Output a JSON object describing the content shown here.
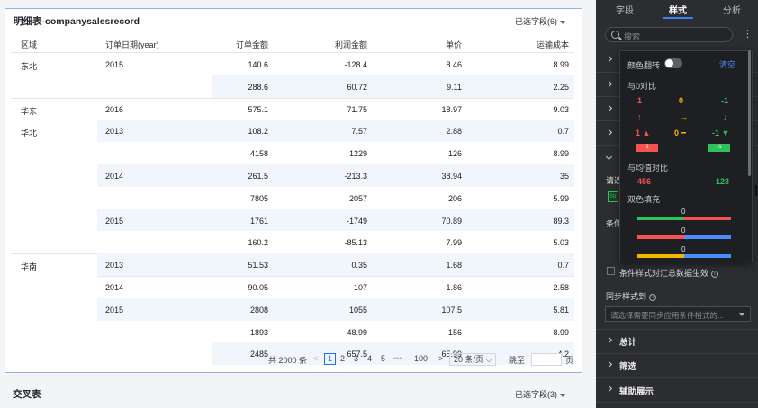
{
  "table_card": {
    "title": "明细表-companysalesrecord",
    "fields_selected": "已选字段(6)",
    "columns": [
      "区域",
      "订单日期(year)",
      "订单金额",
      "利润金额",
      "单价",
      "运输成本"
    ],
    "rows": [
      {
        "region": "东北",
        "year": "2015",
        "amount": "140.6",
        "profit": "-128.4",
        "price": "8.46",
        "cost": "8.99"
      },
      {
        "region": "",
        "year": "",
        "amount": "288.6",
        "profit": "60.72",
        "price": "9.11",
        "cost": "2.25"
      },
      {
        "region": "华东",
        "year": "2016",
        "amount": "575.1",
        "profit": "71.75",
        "price": "18.97",
        "cost": "9.03"
      },
      {
        "region": "华北",
        "year": "2013",
        "amount": "108.2",
        "profit": "7.57",
        "price": "2.88",
        "cost": "0.7"
      },
      {
        "region": "",
        "year": "",
        "amount": "4158",
        "profit": "1229",
        "price": "126",
        "cost": "8.99"
      },
      {
        "region": "",
        "year": "2014",
        "amount": "261.5",
        "profit": "-213.3",
        "price": "38.94",
        "cost": "35"
      },
      {
        "region": "",
        "year": "",
        "amount": "7805",
        "profit": "2057",
        "price": "206",
        "cost": "5.99"
      },
      {
        "region": "",
        "year": "2015",
        "amount": "1761",
        "profit": "-1749",
        "price": "70.89",
        "cost": "89.3"
      },
      {
        "region": "",
        "year": "",
        "amount": "160.2",
        "profit": "-85.13",
        "price": "7.99",
        "cost": "5.03"
      },
      {
        "region": "华南",
        "year": "2013",
        "amount": "51.53",
        "profit": "0.35",
        "price": "1.68",
        "cost": "0.7"
      },
      {
        "region": "",
        "year": "2014",
        "amount": "90.05",
        "profit": "-107",
        "price": "1.86",
        "cost": "2.58"
      },
      {
        "region": "",
        "year": "2015",
        "amount": "2808",
        "profit": "1055",
        "price": "107.5",
        "cost": "5.81"
      },
      {
        "region": "",
        "year": "",
        "amount": "1893",
        "profit": "48.99",
        "price": "156",
        "cost": "8.99"
      },
      {
        "region": "",
        "year": "",
        "amount": "2485",
        "profit": "657.5",
        "price": "65.99",
        "cost": "4.2"
      }
    ],
    "pagination": {
      "total": "共 2000 条",
      "prev": "<",
      "pages": [
        "1",
        "2",
        "3",
        "4",
        "5"
      ],
      "ellipsis": "•••",
      "last": "100",
      "next": ">",
      "page_size": "20 条/页",
      "jump_label": "跳至",
      "page_suffix": "页"
    }
  },
  "cross_card": {
    "title": "交叉表",
    "fields_selected": "已选字段(3)"
  },
  "panel": {
    "tabs": [
      "字段",
      "样式",
      "分析"
    ],
    "search_placeholder": "搜索",
    "partial_label_1": "请选",
    "partial_pill": "Str",
    "partial_label_2": "条件",
    "summary_checkbox": "条件样式对汇总数据生效",
    "sync_label": "同步样式到",
    "sync_placeholder": "请选择需要同步应用条件格式的...",
    "sections": [
      "总计",
      "筛选",
      "辅助展示"
    ]
  },
  "popup": {
    "flip_label": "颜色翻转",
    "clear": "清空",
    "zero_compare": "与0对比",
    "nums": [
      "1",
      "0",
      "-1"
    ],
    "arrow_row": [
      "↑",
      "→",
      "↓"
    ],
    "arrow_text_row": [
      "1",
      "0",
      "-1"
    ],
    "badges": [
      "1",
      "-1"
    ],
    "mean_compare": "与均值对比",
    "mean_values": [
      "456",
      "123"
    ],
    "dual_fill": "双色填充",
    "bar_zero": "0",
    "colors": {
      "red": "#f5534f",
      "yellow": "#f5b400",
      "green": "#2fc25b",
      "blue": "#4b8dff"
    }
  }
}
